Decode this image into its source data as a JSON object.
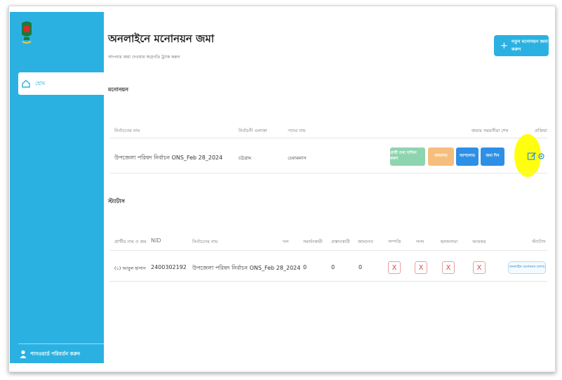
{
  "sidebar": {
    "nav_items": [
      {
        "label": "হোম",
        "icon": "home-icon"
      }
    ],
    "footer_label": "পাসওয়ার্ড পরিবর্তন করুন"
  },
  "header": {
    "title": "অনলাইনে মনোনয়ন জমা",
    "subtitle": "আপনার জমা দেওয়ার অগ্রগতি ট্র্যাক করুন",
    "new_button_label": "নতুন মনোনয়ন জমা করুন"
  },
  "nominations": {
    "section_title": "মনোনয়ন",
    "columns": [
      "নির্বাচনের নাম",
      "নির্বাচনী এলাকা",
      "পদের নাম",
      "জমার সময়সীমা শেষ",
      "প্রক্রিয়া"
    ],
    "rows": [
      {
        "election": "উপজেলা পরিষদ নির্বাচন ONS_Feb 28_2024",
        "area": "চট্টগ্রাম",
        "post": "চেয়ারম্যান",
        "actions": [
          {
            "label": "প্রার্থী তথ্য দাখিল করুন",
            "color": "#8fd4b0"
          },
          {
            "label": "জামানত",
            "color": "#f5be7d"
          },
          {
            "label": "আপলোড",
            "color": "#2d8fe6"
          },
          {
            "label": "জমা দিন",
            "color": "#2d8fe6"
          }
        ]
      }
    ]
  },
  "status": {
    "section_title": "স্ট্যাটাস",
    "columns": [
      "প্রার্থীর নাম ও ক্রম",
      "NID",
      "নির্বাচনের নাম",
      "দল",
      "সমর্থনকারী",
      "প্রস্তাবকারী",
      "জামানত",
      "সম্পত্তি",
      "সনদ",
      "হলফনামা",
      "আয়কর",
      "স্ট্যাটাস"
    ],
    "rows": [
      {
        "candidate": "(১) আবুল হাসান",
        "nid": "2400302192",
        "election": "উপজেলা পরিষদ নির্বাচন ONS_Feb 28_2024",
        "n1": "0",
        "n2": "0",
        "n3": "0",
        "marks": [
          "X",
          "X",
          "X",
          "X"
        ],
        "status_button": "অনলাইন মনোনয়ন চলছে"
      }
    ]
  },
  "colors": {
    "accent": "#2ab1e1",
    "highlight": "#ffff00",
    "danger": "#e04848"
  }
}
